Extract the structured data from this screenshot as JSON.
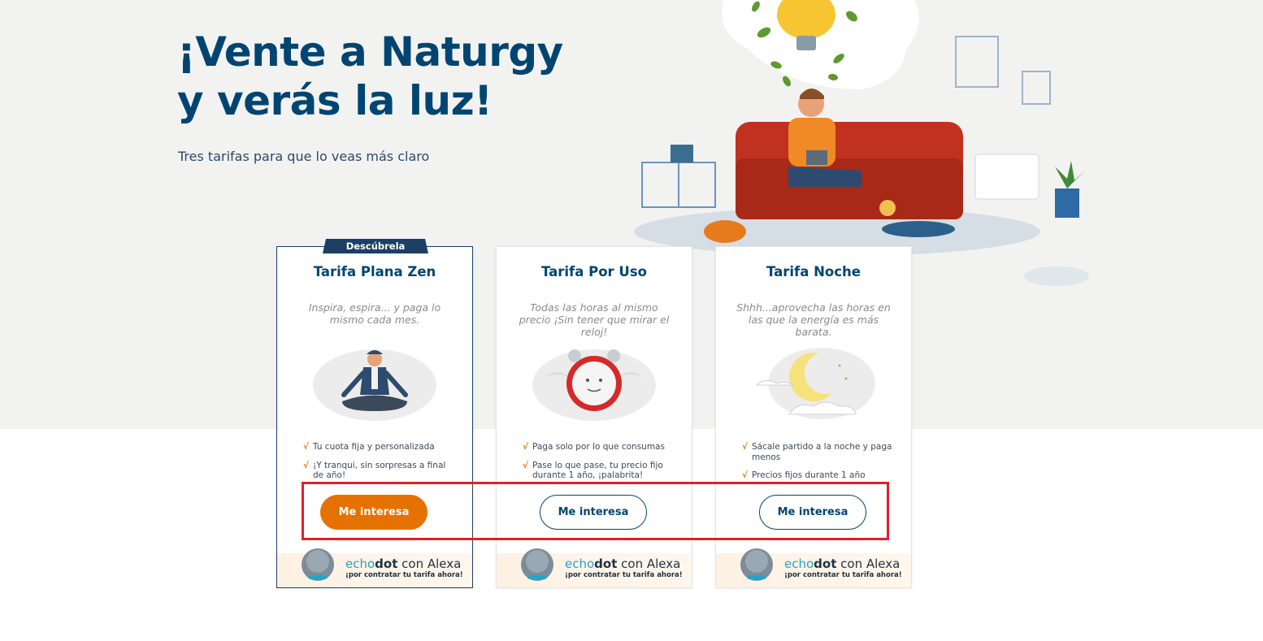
{
  "hero": {
    "title_line1": "¡Vente a Naturgy",
    "title_line2": "y verás la luz!",
    "subtitle": "Tres tarifas para que lo veas más claro"
  },
  "colors": {
    "brand_navy": "#004571",
    "accent_orange": "#e57200",
    "highlight_red": "#e0202a",
    "echo_blue": "#20a6c9"
  },
  "cards": [
    {
      "tag": "Descúbrela",
      "title": "Tarifa Plana Zen",
      "description": "Inspira, espira... y paga lo mismo cada mes.",
      "illustration": "meditating-man-icon",
      "features": [
        "Tu cuota fija y personalizada",
        "¡Y tranqui, sin sorpresas a final de año!"
      ],
      "button": "Me interesa",
      "button_style": "primary",
      "promo": {
        "echo": "echo",
        "dot": "dot",
        "rest": " con Alexa",
        "sub": "¡por contratar tu tarifa ahora!"
      }
    },
    {
      "title": "Tarifa Por Uso",
      "description": "Todas las horas al mismo precio ¡Sin tener que mirar el reloj!",
      "illustration": "alarm-clock-icon",
      "features": [
        "Paga solo por lo que consumas",
        "Pase lo que pase, tu precio fijo durante 1 año, ¡palabrita!"
      ],
      "button": "Me interesa",
      "button_style": "outline",
      "promo": {
        "echo": "echo",
        "dot": "dot",
        "rest": " con Alexa",
        "sub": "¡por contratar tu tarifa ahora!"
      }
    },
    {
      "title": "Tarifa Noche",
      "description": "Shhh...aprovecha las horas en las que la energía es más barata.",
      "illustration": "moon-cloud-icon",
      "features": [
        "Sácale partido a la noche y paga menos",
        "Precios fijos durante 1 año"
      ],
      "button": "Me interesa",
      "button_style": "outline",
      "promo": {
        "echo": "echo",
        "dot": "dot",
        "rest": " con Alexa",
        "sub": "¡por contratar tu tarifa ahora!"
      }
    }
  ],
  "check_mark": "√"
}
